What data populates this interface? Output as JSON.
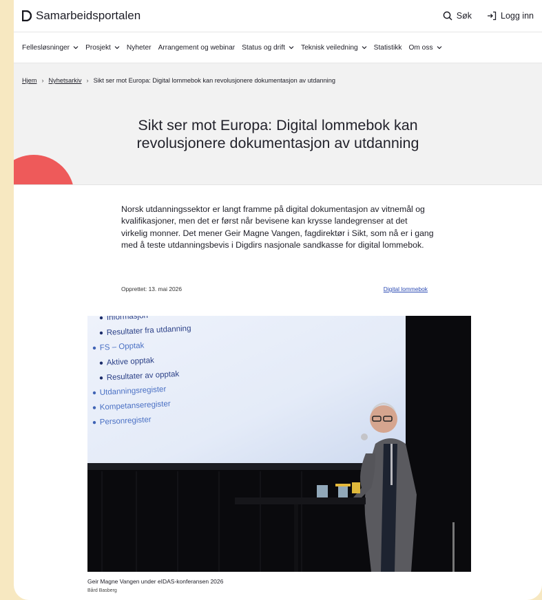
{
  "header": {
    "brand": "Samarbeidsportalen",
    "search_label": "Søk",
    "login_label": "Logg inn"
  },
  "nav": {
    "items": [
      {
        "label": "Fellesløsninger",
        "dropdown": true
      },
      {
        "label": "Prosjekt",
        "dropdown": true
      },
      {
        "label": "Nyheter",
        "dropdown": false
      },
      {
        "label": "Arrangement og webinar",
        "dropdown": false
      },
      {
        "label": "Status og drift",
        "dropdown": true
      },
      {
        "label": "Teknisk veiledning",
        "dropdown": true
      },
      {
        "label": "Statistikk",
        "dropdown": false
      },
      {
        "label": "Om oss",
        "dropdown": true
      }
    ]
  },
  "breadcrumb": {
    "home": "Hjem",
    "archive": "Nyhetsarkiv",
    "current": "Sikt ser mot Europa: Digital lommebok kan revolusjonere dokumentasjon av utdanning"
  },
  "article": {
    "title": "Sikt ser mot Europa: Digital lommebok kan revolusjonere dokumentasjon av utdanning",
    "lead": "Norsk utdanningssektor er langt framme på digital dokumentasjon av vitnemål og kvalifikasjoner, men det er først når bevisene kan krysse landegrenser at det virkelig monner. Det mener Geir Magne Vangen, fagdirektør i Sikt, som nå er i gang med å teste utdanningsbevis i Digdirs nasjonale sandkasse for digital lommebok.",
    "created": "Opprettet: 13. mai 2026",
    "tag": "Digital lommebok",
    "caption": "Geir Magne Vangen under eIDAS-konferansen 2026",
    "credit": "Bård Basberg"
  },
  "slide": {
    "lines": [
      {
        "text": "Informasjon",
        "level": 2
      },
      {
        "text": "Resultater fra utdanning",
        "level": 2
      },
      {
        "text": "FS – Opptak",
        "level": 1
      },
      {
        "text": "Aktive opptak",
        "level": 2
      },
      {
        "text": "Resultater av opptak",
        "level": 2
      },
      {
        "text": "Utdanningsregister",
        "level": 1
      },
      {
        "text": "Kompetanseregister",
        "level": 1
      },
      {
        "text": "Personregister",
        "level": 1
      }
    ]
  },
  "colors": {
    "accent_red": "#ee5a5a",
    "link_blue": "#2b4ab3",
    "background": "#f7e8c1"
  }
}
